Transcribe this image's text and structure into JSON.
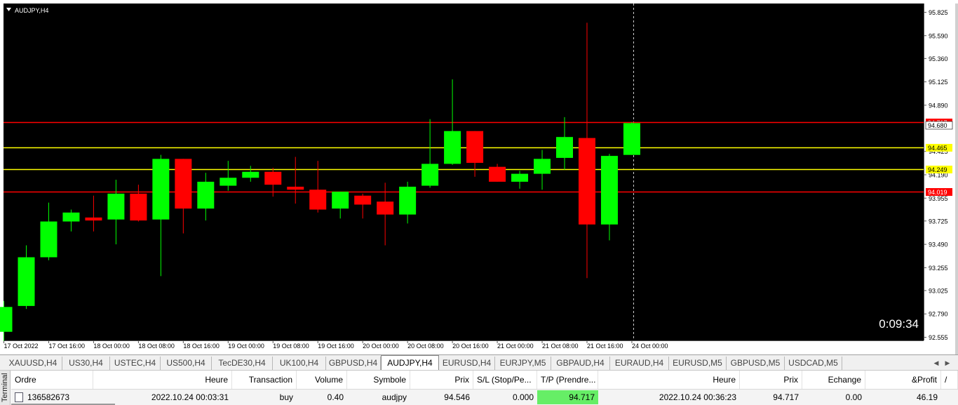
{
  "chart": {
    "title": "AUDJPY,H4",
    "countdown": "0:09:34",
    "price_axis": {
      "labels": [
        "95.825",
        "95.590",
        "95.360",
        "95.125",
        "94.890",
        "94.425",
        "94.190",
        "93.955",
        "93.725",
        "93.490",
        "93.255",
        "93.025",
        "92.790",
        "92.555"
      ]
    },
    "time_axis": {
      "labels": [
        "17 Oct 2022",
        "17 Oct 16:00",
        "18 Oct 00:00",
        "18 Oct 08:00",
        "18 Oct 16:00",
        "19 Oct 00:00",
        "19 Oct 08:00",
        "19 Oct 16:00",
        "20 Oct 00:00",
        "20 Oct 08:00",
        "20 Oct 16:00",
        "21 Oct 00:00",
        "21 Oct 08:00",
        "21 Oct 16:00",
        "24 Oct 00:00"
      ]
    },
    "levels": [
      {
        "price": 94.717,
        "label": "94.717",
        "color": "#ff0000"
      },
      {
        "price": 94.465,
        "label": "94.465",
        "color": "#ffff00"
      },
      {
        "price": 94.249,
        "label": "94.249",
        "color": "#ffff00"
      },
      {
        "price": 94.019,
        "label": "94.019",
        "color": "#ff0000"
      }
    ],
    "current_price": {
      "label": "94.680"
    },
    "colors": {
      "bull": "#00ff00",
      "bear": "#ff0000",
      "background": "#000000",
      "text": "#ffffff"
    }
  },
  "chart_data": {
    "type": "candlestick",
    "title": "AUDJPY,H4",
    "ylim": [
      92.555,
      95.825
    ],
    "ticks": [
      95.825,
      95.59,
      95.36,
      95.125,
      94.89,
      94.425,
      94.19,
      93.955,
      93.725,
      93.49,
      93.255,
      93.025,
      92.79,
      92.555
    ],
    "candles": [
      {
        "o": 92.61,
        "h": 92.92,
        "l": 92.52,
        "c": 92.86
      },
      {
        "o": 92.87,
        "h": 93.48,
        "l": 92.84,
        "c": 93.36
      },
      {
        "o": 93.36,
        "h": 93.91,
        "l": 93.33,
        "c": 93.72
      },
      {
        "o": 93.72,
        "h": 93.84,
        "l": 93.62,
        "c": 93.81
      },
      {
        "o": 93.76,
        "h": 93.98,
        "l": 93.62,
        "c": 93.73
      },
      {
        "o": 93.74,
        "h": 94.14,
        "l": 93.49,
        "c": 94.0
      },
      {
        "o": 94.0,
        "h": 94.09,
        "l": 93.72,
        "c": 93.73
      },
      {
        "o": 93.74,
        "h": 94.39,
        "l": 93.17,
        "c": 94.35
      },
      {
        "o": 94.35,
        "h": 94.35,
        "l": 93.6,
        "c": 93.85
      },
      {
        "o": 93.85,
        "h": 94.21,
        "l": 93.73,
        "c": 94.12
      },
      {
        "o": 94.08,
        "h": 94.33,
        "l": 94.03,
        "c": 94.16
      },
      {
        "o": 94.16,
        "h": 94.28,
        "l": 94.12,
        "c": 94.22
      },
      {
        "o": 94.22,
        "h": 94.26,
        "l": 93.97,
        "c": 94.09
      },
      {
        "o": 94.07,
        "h": 94.37,
        "l": 93.9,
        "c": 94.04
      },
      {
        "o": 94.04,
        "h": 94.33,
        "l": 93.81,
        "c": 93.84
      },
      {
        "o": 93.85,
        "h": 94.0,
        "l": 93.75,
        "c": 94.02
      },
      {
        "o": 93.98,
        "h": 94.0,
        "l": 93.75,
        "c": 93.89
      },
      {
        "o": 93.92,
        "h": 94.11,
        "l": 93.48,
        "c": 93.79
      },
      {
        "o": 93.79,
        "h": 94.12,
        "l": 93.7,
        "c": 94.07
      },
      {
        "o": 94.08,
        "h": 94.75,
        "l": 94.06,
        "c": 94.3
      },
      {
        "o": 94.3,
        "h": 95.15,
        "l": 94.29,
        "c": 94.63
      },
      {
        "o": 94.63,
        "h": 94.63,
        "l": 94.17,
        "c": 94.31
      },
      {
        "o": 94.27,
        "h": 94.3,
        "l": 94.12,
        "c": 94.12
      },
      {
        "o": 94.12,
        "h": 94.23,
        "l": 94.05,
        "c": 94.2
      },
      {
        "o": 94.2,
        "h": 94.44,
        "l": 94.04,
        "c": 94.35
      },
      {
        "o": 94.36,
        "h": 94.77,
        "l": 94.24,
        "c": 94.57
      },
      {
        "o": 94.56,
        "h": 95.72,
        "l": 93.15,
        "c": 93.69
      },
      {
        "o": 93.69,
        "h": 94.4,
        "l": 93.53,
        "c": 94.38
      },
      {
        "o": 94.39,
        "h": 94.72,
        "l": 94.39,
        "c": 94.71
      }
    ]
  },
  "tabs": [
    {
      "label": "XAUUSD,H4",
      "active": false
    },
    {
      "label": "US30,H4",
      "active": false
    },
    {
      "label": "USTEC,H4",
      "active": false
    },
    {
      "label": "US500,H4",
      "active": false
    },
    {
      "label": "TecDE30,H4",
      "active": false
    },
    {
      "label": "UK100,H4",
      "active": false
    },
    {
      "label": "GBPUSD,H4",
      "active": false
    },
    {
      "label": "AUDJPY,H4",
      "active": true
    },
    {
      "label": "EURUSD,H4",
      "active": false
    },
    {
      "label": "EURJPY,M5",
      "active": false
    },
    {
      "label": "GBPAUD,H4",
      "active": false
    },
    {
      "label": "EURAUD,H4",
      "active": false
    },
    {
      "label": "EURUSD,M5",
      "active": false
    },
    {
      "label": "GBPUSD,M5",
      "active": false
    },
    {
      "label": "USDCAD,M5",
      "active": false
    }
  ],
  "terminal": {
    "side_label": "Terminal",
    "columns": [
      "Ordre",
      "Heure",
      "Transaction",
      "Volume",
      "Symbole",
      "Prix",
      "S/L (Stop/Pe...",
      "T/P (Prendre...",
      "Heure",
      "Prix",
      "Echange",
      "&Profit"
    ],
    "sort_icon": "/",
    "row": [
      "136582673",
      "2022.10.24 00:03:31",
      "buy",
      "0.40",
      "audjpy",
      "94.546",
      "0.000",
      "94.717",
      "2022.10.24 00:36:23",
      "94.717",
      "0.00",
      "46.19"
    ]
  }
}
